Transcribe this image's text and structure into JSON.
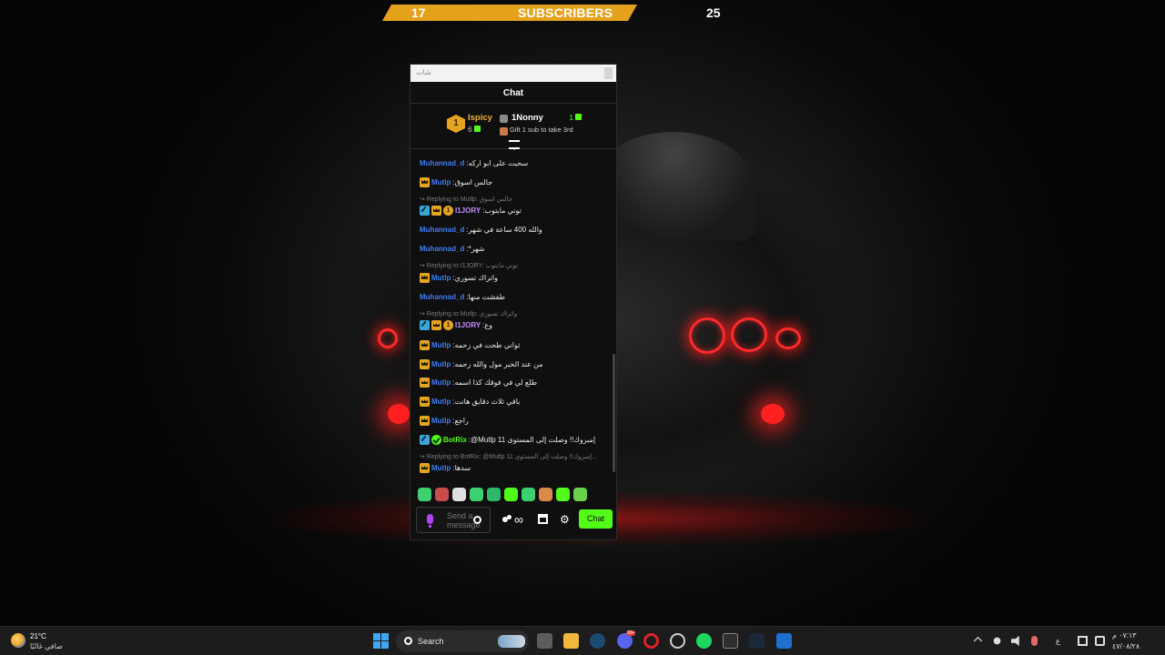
{
  "sub_goal": {
    "left_count": "17",
    "label": "SUBSCRIBERS",
    "right_count": "25"
  },
  "chat_window": {
    "titlebar_text": "شات",
    "header_title": "Chat",
    "leaderboard": {
      "first": {
        "rank": "1",
        "name": "Ispicy",
        "count": "6"
      },
      "second": {
        "name": "1Nonny",
        "count": "1"
      },
      "gift_prompt": "Gift 1 sub to take 3rd"
    },
    "messages": [
      {
        "user": "Muhannad_d",
        "color": "blue",
        "badges": [],
        "text": "سحبت على ابو اركه"
      },
      {
        "user": "Mutlp",
        "color": "blue",
        "badges": [
          "crown"
        ],
        "text": "جالس اسوق"
      },
      {
        "reply": "Replying to Mutlp: جالس اسوق",
        "user": "I1JORY",
        "color": "purple",
        "badges": [
          "hammer",
          "crown",
          "gold"
        ],
        "text": "توني مابتوب"
      },
      {
        "user": "Muhannad_d",
        "color": "blue",
        "badges": [],
        "text": "والله 400 ساعة في شهر"
      },
      {
        "user": "Muhannad_d",
        "color": "blue",
        "badges": [],
        "text": "*شهر"
      },
      {
        "reply": "Replying to I1JORY: توني مابتوب",
        "user": "Mutlp",
        "color": "blue",
        "badges": [
          "crown"
        ],
        "text": "واتراك تسوري"
      },
      {
        "user": "Muhannad_d",
        "color": "blue",
        "badges": [],
        "text": "طفشت منها"
      },
      {
        "reply": "Replying to Mutlp: واتراك تسوري",
        "user": "I1JORY",
        "color": "purple",
        "badges": [
          "hammer",
          "crown",
          "gold"
        ],
        "text": "وع"
      },
      {
        "user": "Mutlp",
        "color": "blue",
        "badges": [
          "crown"
        ],
        "text": "ثواني طحت في زحمه"
      },
      {
        "user": "Mutlp",
        "color": "blue",
        "badges": [
          "crown"
        ],
        "text": "من عند الخبر مول والله زحمه"
      },
      {
        "user": "Mutlp",
        "color": "blue",
        "badges": [
          "crown"
        ],
        "text": "طلع لي في فوقك كذا اسمه"
      },
      {
        "user": "Mutlp",
        "color": "blue",
        "badges": [
          "crown"
        ],
        "text": "باقي ثلاث دقايق هانت"
      },
      {
        "user": "Mutlp",
        "color": "blue",
        "badges": [
          "crown"
        ],
        "text": "راجع"
      },
      {
        "user": "BotRix",
        "color": "green",
        "badges": [
          "hammer",
          "verified"
        ],
        "text": "@Mutlp 11 إمبروك!! وصلت إلى المستوى"
      },
      {
        "reply": "Replying to BotRix: @Mutlp 11 إمبروك!! وصلت إلى المستوى...",
        "user": "Mutlp",
        "color": "blue",
        "badges": [
          "crown"
        ],
        "text": "سدها"
      }
    ],
    "emotes": [
      "#3bd16f",
      "#c94b4b",
      "#e0e0e0",
      "#3bd16f",
      "#2fb86a",
      "#53fc18",
      "#3bd16f",
      "#d98a4a",
      "#53fc18",
      "#6ad14b"
    ],
    "input": {
      "placeholder": "Send a message",
      "send_label": "Chat"
    }
  },
  "taskbar": {
    "weather_temp": "21°C",
    "weather_desc": "صافي غالبًا",
    "search_label": "Search",
    "discord_badge": "99+",
    "lang": "ع",
    "time": "٠٧:١٣ م",
    "date": "٤٧/٠٨/٢٨"
  },
  "colors": {
    "kick_green": "#53fc18",
    "gold": "#e6a521",
    "link_blue": "#3f7ef1",
    "mod_blue": "#3aa7d8"
  }
}
